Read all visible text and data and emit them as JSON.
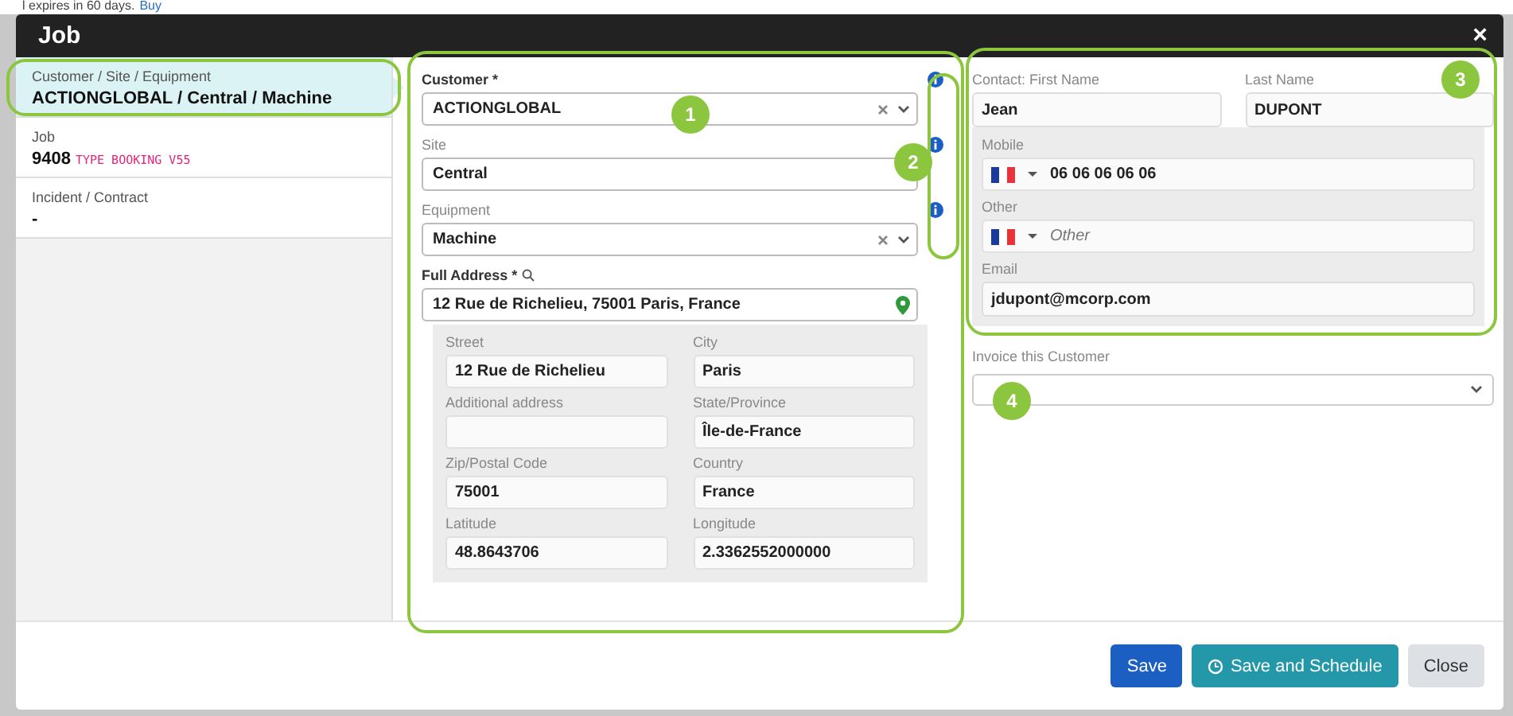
{
  "background_notice": {
    "text": "l expires in 60 days.",
    "link": "Buy"
  },
  "window": {
    "title": "Job",
    "close": "×"
  },
  "sidebar": {
    "items": [
      {
        "label": "Customer / Site / Equipment",
        "value": "ACTIONGLOBAL / Central / Machine",
        "selected": true
      },
      {
        "label": "Job",
        "value": "9408",
        "tag": "TYPE BOOKING V55",
        "selected": false
      },
      {
        "label": "Incident / Contract",
        "value": "-",
        "selected": false
      }
    ]
  },
  "customer_form": {
    "selects": [
      {
        "label": "Customer *",
        "value": "ACTIONGLOBAL",
        "required": true,
        "clearable": true
      },
      {
        "label": "Site",
        "value": "Central",
        "required": false,
        "clearable": false
      },
      {
        "label": "Equipment",
        "value": "Machine",
        "required": false,
        "clearable": true
      }
    ],
    "address": {
      "label": "Full Address *",
      "value": "12 Rue de Richelieu, 75001 Paris, France",
      "fields": [
        {
          "label": "Street",
          "value": "12 Rue de Richelieu"
        },
        {
          "label": "City",
          "value": "Paris"
        },
        {
          "label": "Additional address"
        },
        {
          "label": "State/Province",
          "value": "Île-de-France"
        },
        {
          "label": "Zip/Postal Code",
          "value": "75001"
        },
        {
          "label": "Country",
          "value": "France"
        },
        {
          "label": "Latitude",
          "value": "48.8643706"
        },
        {
          "label": "Longitude",
          "value": "2.3362552000000"
        }
      ]
    }
  },
  "contact": {
    "first_name": {
      "label": "Contact: First Name",
      "value": "Jean"
    },
    "last_name": {
      "label": "Last Name",
      "value": "DUPONT"
    },
    "phones": [
      {
        "label": "Mobile",
        "value": "06 06 06 06 06"
      },
      {
        "label": "Other",
        "placeholder": "Other"
      }
    ],
    "email": {
      "label": "Email",
      "value": "jdupont@mcorp.com"
    }
  },
  "invoice": {
    "label": "Invoice this Customer"
  },
  "buttons": [
    {
      "label": "Save",
      "kind": "primary"
    },
    {
      "label": "Save and Schedule",
      "kind": "schedule"
    },
    {
      "label": "Close",
      "kind": "secondary"
    }
  ],
  "annotations": [
    {
      "number": "1"
    },
    {
      "number": "2"
    },
    {
      "number": "3"
    },
    {
      "number": "4"
    }
  ]
}
